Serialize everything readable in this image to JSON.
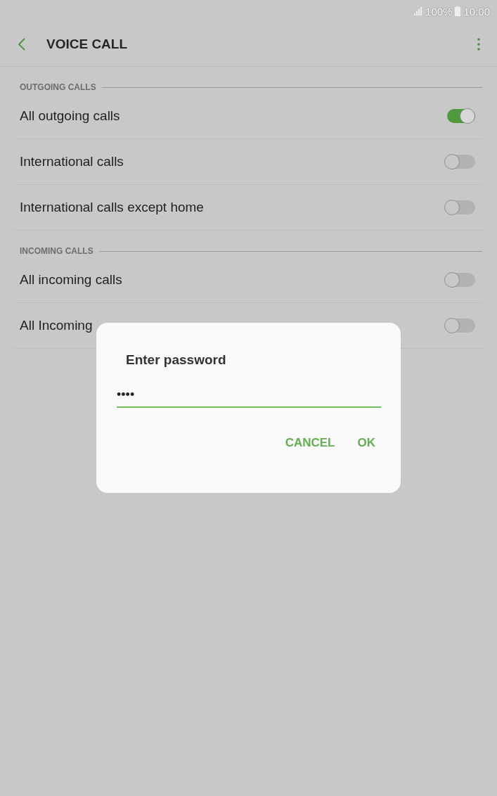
{
  "status_bar": {
    "battery": "100%",
    "time": "10:00"
  },
  "header": {
    "title": "VOICE CALL"
  },
  "sections": [
    {
      "title": "OUTGOING CALLS",
      "items": [
        {
          "label": "All outgoing calls",
          "on": true
        },
        {
          "label": "International calls",
          "on": false
        },
        {
          "label": "International calls except home",
          "on": false
        }
      ]
    },
    {
      "title": "INCOMING CALLS",
      "items": [
        {
          "label": "All incoming calls",
          "on": false
        },
        {
          "label": "All Incoming",
          "on": false
        }
      ]
    }
  ],
  "dialog": {
    "title": "Enter password",
    "password": "••••",
    "buttons": [
      "CANCEL",
      "OK"
    ]
  }
}
